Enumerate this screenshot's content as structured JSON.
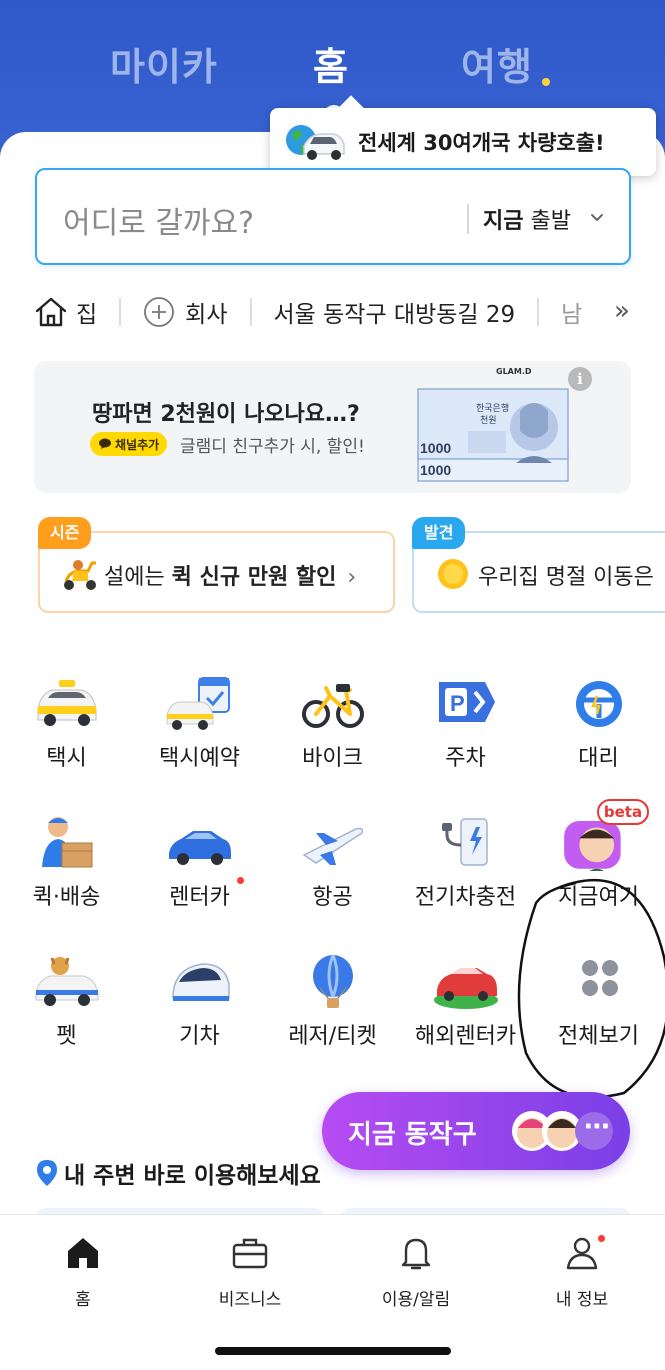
{
  "header": {
    "tabs": [
      {
        "label": "마이카",
        "active": false
      },
      {
        "label": "홈",
        "active": true
      },
      {
        "label": "여행",
        "active": false,
        "has_dot": true
      }
    ],
    "tooltip": "전세계 30여개국 차량호출!"
  },
  "search": {
    "placeholder": "어디로 갈까요?",
    "depart_bold": "지금",
    "depart_rest": " 출발"
  },
  "shortcuts": [
    {
      "label": "집",
      "icon": "home-icon"
    },
    {
      "label": "회사",
      "icon": "plus-circle-icon"
    },
    {
      "label": "서울 동작구 대방동길 29"
    },
    {
      "label": "남"
    }
  ],
  "shortcuts_more": "»",
  "banner": {
    "title": "땅파면 2천원이 나오나요…?",
    "chip": "채널추가",
    "subtitle": "글램디 친구추가 시, 할인!",
    "brand": "GLAM.D",
    "info": "i",
    "bill_value": "1000"
  },
  "cards": [
    {
      "badge": "시즌",
      "text_pre": "설에는 ",
      "text_bold": "퀵 신규 만원 할인",
      "chevron": "›",
      "accent": "#ff9d1c"
    },
    {
      "badge": "발견",
      "text_pre": "우리집 명절 이동은",
      "accent": "#29a8ef"
    }
  ],
  "services": [
    {
      "label": "택시",
      "icon": "taxi-icon"
    },
    {
      "label": "택시예약",
      "icon": "taxi-reservation-icon"
    },
    {
      "label": "바이크",
      "icon": "bike-icon"
    },
    {
      "label": "주차",
      "icon": "parking-icon"
    },
    {
      "label": "대리",
      "icon": "steering-wheel-icon"
    },
    {
      "label": "퀵·배송",
      "icon": "delivery-icon"
    },
    {
      "label": "렌터카",
      "icon": "rental-car-icon",
      "has_dot": true
    },
    {
      "label": "항공",
      "icon": "airplane-icon"
    },
    {
      "label": "전기차충전",
      "icon": "ev-charger-icon"
    },
    {
      "label": "지금여기",
      "icon": "now-here-icon",
      "badge": "beta"
    },
    {
      "label": "펫",
      "icon": "pet-taxi-icon"
    },
    {
      "label": "기차",
      "icon": "train-icon"
    },
    {
      "label": "레저/티켓",
      "icon": "balloon-icon"
    },
    {
      "label": "해외렌터카",
      "icon": "overseas-rental-icon"
    },
    {
      "label": "전체보기",
      "icon": "grid-icon"
    }
  ],
  "now_pill": {
    "label": "지금 동작구",
    "more": "⋯"
  },
  "nearby": {
    "title": "내 주변 바로 이용해보세요"
  },
  "bottom_nav": [
    {
      "label": "홈",
      "icon": "home-icon",
      "active": true
    },
    {
      "label": "비즈니스",
      "icon": "briefcase-icon"
    },
    {
      "label": "이용/알림",
      "icon": "bell-icon"
    },
    {
      "label": "내 정보",
      "icon": "person-icon",
      "has_dot": true
    }
  ],
  "colors": {
    "header_blue": "#2f58c8",
    "search_border": "#3aa6f3",
    "pill_purple": "#8a44ea",
    "season_orange": "#ff9d1c",
    "discover_blue": "#29a8ef",
    "chip_yellow": "#ffd900"
  }
}
